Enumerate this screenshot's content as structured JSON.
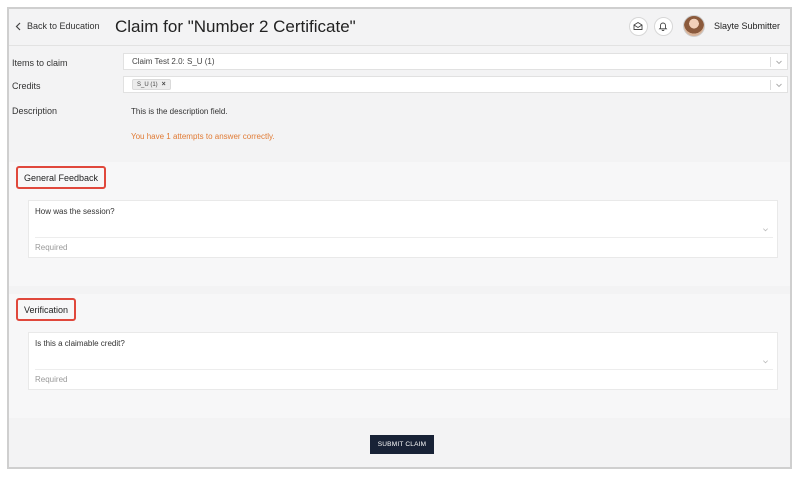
{
  "header": {
    "back_label": "Back to Education",
    "title": "Claim for \"Number 2 Certificate\"",
    "user_name": "Slayte Submitter",
    "icons": [
      "mail-icon",
      "bell-icon"
    ]
  },
  "form": {
    "items_label": "Items to claim",
    "items_value": "Claim Test 2.0: S_U (1)",
    "credits_label": "Credits",
    "credit_tag": "S_U (1)",
    "credit_tag_remove": "×",
    "description_label": "Description",
    "description_text": "This is the description field.",
    "attempts_text": "You have 1 attempts to answer correctly."
  },
  "sections": [
    {
      "title": "General Feedback",
      "question": "How was the session?",
      "helper": "Required"
    },
    {
      "title": "Verification",
      "question": "Is this a claimable credit?",
      "helper": "Required"
    }
  ],
  "submit_label": "SUBMIT CLAIM",
  "colors": {
    "accent_orange": "#e07b35",
    "highlight_red": "#e0483c",
    "submit_bg": "#182236"
  }
}
